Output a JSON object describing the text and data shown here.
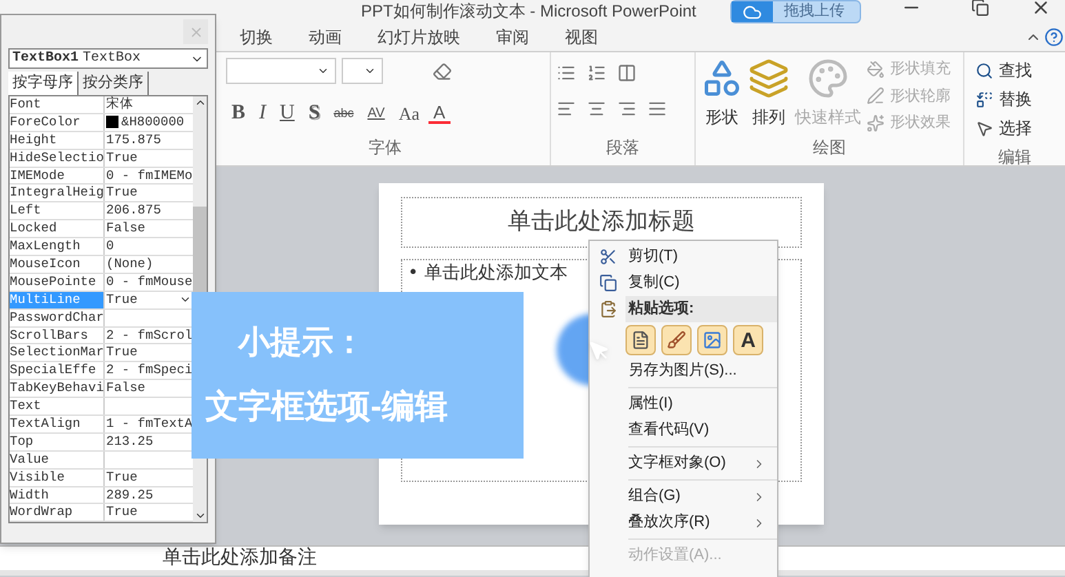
{
  "window": {
    "title": "PPT如何制作滚动文本 - Microsoft PowerPoint",
    "upload_button": "拖拽上传"
  },
  "ribbon_tabs": [
    {
      "label": "切换",
      "selected": false
    },
    {
      "label": "动画",
      "selected": false
    },
    {
      "label": "幻灯片放映",
      "selected": false
    },
    {
      "label": "审阅",
      "selected": false
    },
    {
      "label": "视图",
      "selected": false
    }
  ],
  "ribbon": {
    "font_group": {
      "label": "字体",
      "format_buttons": [
        {
          "label": "B",
          "kind": "bold"
        },
        {
          "label": "I",
          "kind": "italic"
        },
        {
          "label": "U",
          "kind": "underline"
        },
        {
          "label": "S",
          "kind": "shadow"
        },
        {
          "label": "abc",
          "kind": "strike"
        },
        {
          "label": "AV",
          "kind": "spacing"
        },
        {
          "label": "Aa",
          "kind": "case"
        },
        {
          "label": "A",
          "kind": "color"
        }
      ]
    },
    "paragraph_group": {
      "label": "段落"
    },
    "drawing_group": {
      "label": "绘图",
      "big_buttons": [
        {
          "label": "形状",
          "kind": "shapes",
          "disabled": false
        },
        {
          "label": "排列",
          "kind": "arrange",
          "disabled": false
        },
        {
          "label": "快速样式",
          "kind": "styles",
          "disabled": true
        }
      ],
      "small_buttons": [
        {
          "label": "形状填充",
          "kind": "fill",
          "disabled": true
        },
        {
          "label": "形状轮廓",
          "kind": "outline",
          "disabled": true
        },
        {
          "label": "形状效果",
          "kind": "effects",
          "disabled": true
        }
      ]
    },
    "editing_group": {
      "label": "编辑",
      "buttons": [
        {
          "label": "查找",
          "kind": "find"
        },
        {
          "label": "替换",
          "kind": "replace"
        },
        {
          "label": "选择",
          "kind": "select"
        }
      ]
    }
  },
  "slide": {
    "title_placeholder": "单击此处添加标题",
    "bullet": "•",
    "body_placeholder": "单击此处添加文本"
  },
  "notes_placeholder": "单击此处添加备注",
  "properties": {
    "object": "TextBox1",
    "object_type": "TextBox",
    "tabs": [
      {
        "label": "按字母序",
        "selected": true
      },
      {
        "label": "按分类序",
        "selected": false
      }
    ],
    "rows": [
      {
        "name": "Font",
        "value": "宋体",
        "selected": false
      },
      {
        "name": "ForeColor",
        "value": "&H800000",
        "color": "#000000",
        "selected": false
      },
      {
        "name": "Height",
        "value": "175.875",
        "selected": false
      },
      {
        "name": "HideSelectio",
        "value": "True",
        "selected": false
      },
      {
        "name": "IMEMode",
        "value": "0 - fmIMEMo",
        "selected": false
      },
      {
        "name": "IntegralHeig",
        "value": "True",
        "selected": false
      },
      {
        "name": "Left",
        "value": "206.875",
        "selected": false
      },
      {
        "name": "Locked",
        "value": "False",
        "selected": false
      },
      {
        "name": "MaxLength",
        "value": "0",
        "selected": false
      },
      {
        "name": "MouseIcon",
        "value": "(None)",
        "selected": false
      },
      {
        "name": "MousePointe",
        "value": "0 - fmMouse",
        "selected": false
      },
      {
        "name": "MultiLine",
        "value": "True",
        "selected": true
      },
      {
        "name": "PasswordChar",
        "selected": false
      },
      {
        "name": "ScrollBars",
        "value": "2 - fmScrol",
        "selected": false
      },
      {
        "name": "SelectionMar",
        "value": "True",
        "selected": false
      },
      {
        "name": "SpecialEffe",
        "value": "2 - fmSpeci",
        "selected": false
      },
      {
        "name": "TabKeyBehavi",
        "value": "False",
        "selected": false
      },
      {
        "name": "Text",
        "selected": false
      },
      {
        "name": "TextAlign",
        "value": "1 - fmTextA",
        "selected": false
      },
      {
        "name": "Top",
        "value": "213.25",
        "selected": false
      },
      {
        "name": "Value",
        "selected": false
      },
      {
        "name": "Visible",
        "value": "True",
        "selected": false
      },
      {
        "name": "Width",
        "value": "289.25",
        "selected": false
      },
      {
        "name": "WordWrap",
        "value": "True",
        "selected": false
      }
    ]
  },
  "context_menu": {
    "items": [
      {
        "kind": "cut",
        "label": "剪切(T)",
        "disabled": false
      },
      {
        "kind": "copy",
        "label": "复制(C)",
        "disabled": false
      },
      {
        "kind": "header",
        "label": "粘贴选项:"
      },
      {
        "kind": "paste_row",
        "options": [
          {
            "kind": "destination"
          },
          {
            "kind": "format"
          },
          {
            "kind": "picture"
          },
          {
            "kind": "text",
            "label": "A"
          }
        ]
      },
      {
        "kind": "item",
        "label": "另存为图片(S)...",
        "disabled": false
      },
      {
        "kind": "separator"
      },
      {
        "kind": "item",
        "label": "属性(I)",
        "disabled": false
      },
      {
        "kind": "item",
        "label": "查看代码(V)",
        "disabled": false
      },
      {
        "kind": "separator"
      },
      {
        "kind": "submenu",
        "label": "文字框对象(O)",
        "disabled": false
      },
      {
        "kind": "separator"
      },
      {
        "kind": "submenu",
        "label": "组合(G)",
        "disabled": false
      },
      {
        "kind": "submenu",
        "label": "叠放次序(R)",
        "disabled": false
      },
      {
        "kind": "separator"
      },
      {
        "kind": "item",
        "label": "动作设置(A)...",
        "disabled": true
      }
    ]
  },
  "tip": {
    "title": "小提示：",
    "text": "文字框选项-编辑"
  }
}
